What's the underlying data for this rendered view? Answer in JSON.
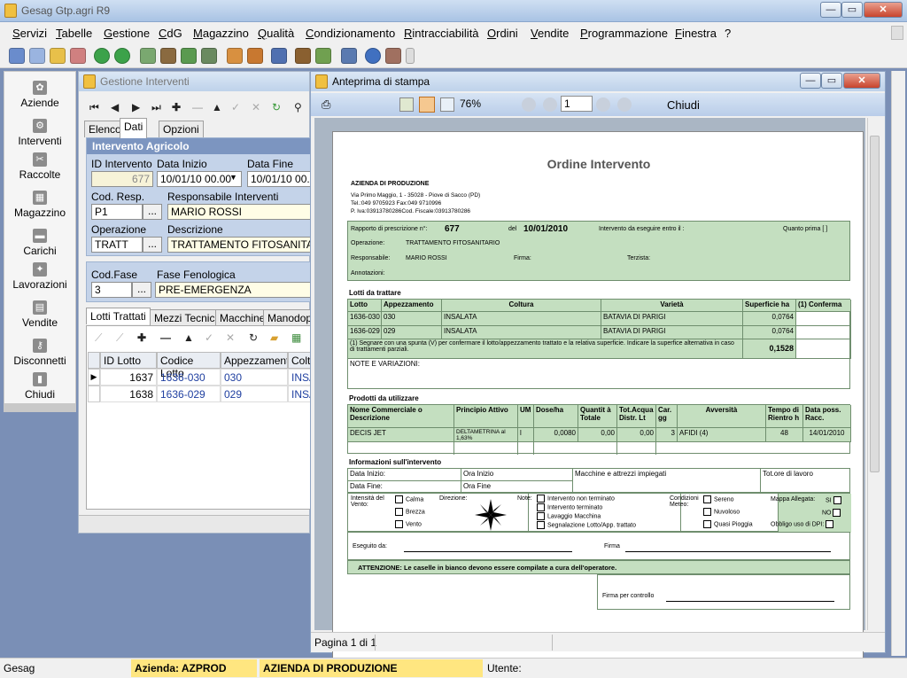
{
  "window": {
    "title": "Gesag Gtp.agri R9",
    "min": "—",
    "max": "▭",
    "close": "✕"
  },
  "menu": [
    "Servizi",
    "Tabelle",
    "Gestione",
    "CdG",
    "Magazzino",
    "Qualità",
    "Condizionamento",
    "Rintracciabilità",
    "Ordini",
    "Vendite",
    "Programmazione",
    "Finestra",
    "?"
  ],
  "sidebar": [
    {
      "label": "Aziende",
      "icon": "flower-icon"
    },
    {
      "label": "Interventi",
      "icon": "tractor-icon"
    },
    {
      "label": "Raccolte",
      "icon": "harvest-icon"
    },
    {
      "label": "Magazzino",
      "icon": "warehouse-icon"
    },
    {
      "label": "Carichi",
      "icon": "truck-icon"
    },
    {
      "label": "Lavorazioni",
      "icon": "processing-icon"
    },
    {
      "label": "Vendite",
      "icon": "sales-icon"
    },
    {
      "label": "Disconnetti",
      "icon": "keys-icon"
    },
    {
      "label": "Chiudi",
      "icon": "door-icon"
    }
  ],
  "interventi": {
    "title": "Gestione Interventi",
    "tabs": [
      "Elenco",
      "Dati",
      "Opzioni"
    ],
    "section_title": "Intervento Agricolo",
    "labels": {
      "id": "ID Intervento",
      "data_inizio": "Data Inizio",
      "data_fine": "Data Fine",
      "cod_resp": "Cod. Resp.",
      "resp": "Responsabile Interventi",
      "operazione": "Operazione",
      "descrizione": "Descrizione",
      "cod_fase": "Cod.Fase",
      "fase": "Fase Fenologica"
    },
    "values": {
      "id": "677",
      "data_inizio": "10/01/10 00.00",
      "data_fine": "10/01/10 00.00",
      "cod_resp": "P1",
      "resp": "MARIO ROSSI",
      "operazione": "TRATT",
      "descrizione": "TRATTAMENTO FITOSANITARIO",
      "cod_fase": "3",
      "fase": "PRE-EMERGENZA"
    },
    "ellipsis": "...",
    "subtabs": [
      "Lotti Trattati",
      "Mezzi Tecnici",
      "Macchine",
      "Manodop"
    ],
    "grid_headers": [
      "ID Lotto",
      "Codice Lotto",
      "Appezzamento",
      "Coltu"
    ],
    "grid_rows": [
      {
        "id": "1637",
        "codice": "1636-030",
        "appezz": "030",
        "coltura": "INSA"
      },
      {
        "id": "1638",
        "codice": "1636-029",
        "appezz": "029",
        "coltura": "INSA"
      }
    ]
  },
  "preview": {
    "title": "Anteprima di stampa",
    "zoom": "76%",
    "page": "1",
    "close_label": "Chiudi",
    "page_status": "Pagina 1 di 1"
  },
  "report": {
    "title": "Ordine Intervento",
    "company": "AZIENDA DI PRODUZIONE",
    "address1": "Via Primo Maggio, 1 - 35028 - Piove di Sacco (PD)",
    "address2": "Tel.:049 9705923  Fax:049 9710996",
    "address3": "P. Iva:03913780286Cod. Fiscale:03913780286",
    "rapporto_label": "Rapporto di prescrizione n°:",
    "rapporto_n": "677",
    "del_label": "del",
    "del_date": "10/01/2010",
    "entro_label": "Intervento da eseguire entro il :",
    "quanto_prima": "Quanto prima [  ]",
    "operazione_label": "Operazione:",
    "operazione": "TRATTAMENTO FITOSANITARIO",
    "responsabile_label": "Responsabile:",
    "responsabile": "MARIO ROSSI",
    "firma_label": "Firma:",
    "terzista_label": "Terzista:",
    "annotazioni_label": "Annotazioni:",
    "lotti_title": "Lotti da trattare",
    "lotti_headers": [
      "Lotto",
      "Appezzamento",
      "Coltura",
      "Varietà",
      "Superficie ha",
      "(1) Conferma"
    ],
    "lotti_rows": [
      {
        "lotto": "1636-030",
        "appezz": "030",
        "coltura": "INSALATA",
        "varieta": "BATAVIA DI PARIGI",
        "sup": "0,0764"
      },
      {
        "lotto": "1636-029",
        "appezz": "029",
        "coltura": "INSALATA",
        "varieta": "BATAVIA DI PARIGI",
        "sup": "0,0764"
      }
    ],
    "lotti_note": "(1) Segnare con una spunta (V) per confermare il lotto/appezzamento trattato e la relativa superficie. Indicare la superfice alternativa in caso di trattamenti parziali.",
    "lotti_total": "0,1528",
    "note_variazioni": "NOTE E VARIAZIONI:",
    "prodotti_title": "Prodotti da utilizzare",
    "prodotti_headers": [
      "Nome Commerciale o Descrizione",
      "Principio Attivo",
      "UM",
      "Dose/ha",
      "Quantit à Totale",
      "Tot.Acqua Distr. Lt",
      "Car. gg",
      "Avversità",
      "Tempo di Rientro h",
      "Data poss. Racc."
    ],
    "prodotti_row": {
      "nome": "DECIS JET",
      "principio": "DELTAMETRINA al 1,63%",
      "um": "l",
      "dose": "0,0080",
      "qta": "0,00",
      "acqua": "0,00",
      "car": "3",
      "avversita": "AFIDI (4)",
      "rientro": "48",
      "data": "14/01/2010"
    },
    "info_title": "Informazioni sull'intervento",
    "data_inizio_label": "Data Inizio:",
    "ora_inizio_label": "Ora Inizio",
    "data_fine_label": "Data Fine:",
    "ora_fine_label": "Ora Fine",
    "macchine_label": "Macchine e attrezzi impiegati",
    "tot_ore_label": "Tot.ore di lavoro",
    "intensita_label": "Intensità del Vento:",
    "vento": [
      "Calma",
      "Brezza",
      "Vento"
    ],
    "direzione_label": "Direzione:",
    "note_label": "Note:",
    "note_opts": [
      "Intervento non terminato",
      "Intervento terminato",
      "Lavaggio Macchina",
      "Segnalazione Lotto/App. trattato"
    ],
    "meteo_label": "Condizioni Meteo:",
    "meteo_opts": [
      "Sereno",
      "Nuvoloso",
      "Quasi Pioggia"
    ],
    "mappa_label": "Mappa Allegata:",
    "si": "SI",
    "no": "NO",
    "dpi_label": "Obbligo uso di DPI:",
    "eseguito_label": "Eseguito da:",
    "firma2_label": "Firma",
    "attenzione": "ATTENZIONE: Le caselle in bianco devono essere compilate a cura dell'operatore.",
    "firma_controllo": "Firma per controllo"
  },
  "status": {
    "app": "Gesag",
    "azienda_label": "Azienda: AZPROD",
    "azienda_name": "AZIENDA DI PRODUZIONE",
    "utente": "Utente:"
  },
  "colors": {
    "accent": "#7c95c0",
    "report_green": "#c4dfc0",
    "status_yellow": "#ffe680"
  }
}
